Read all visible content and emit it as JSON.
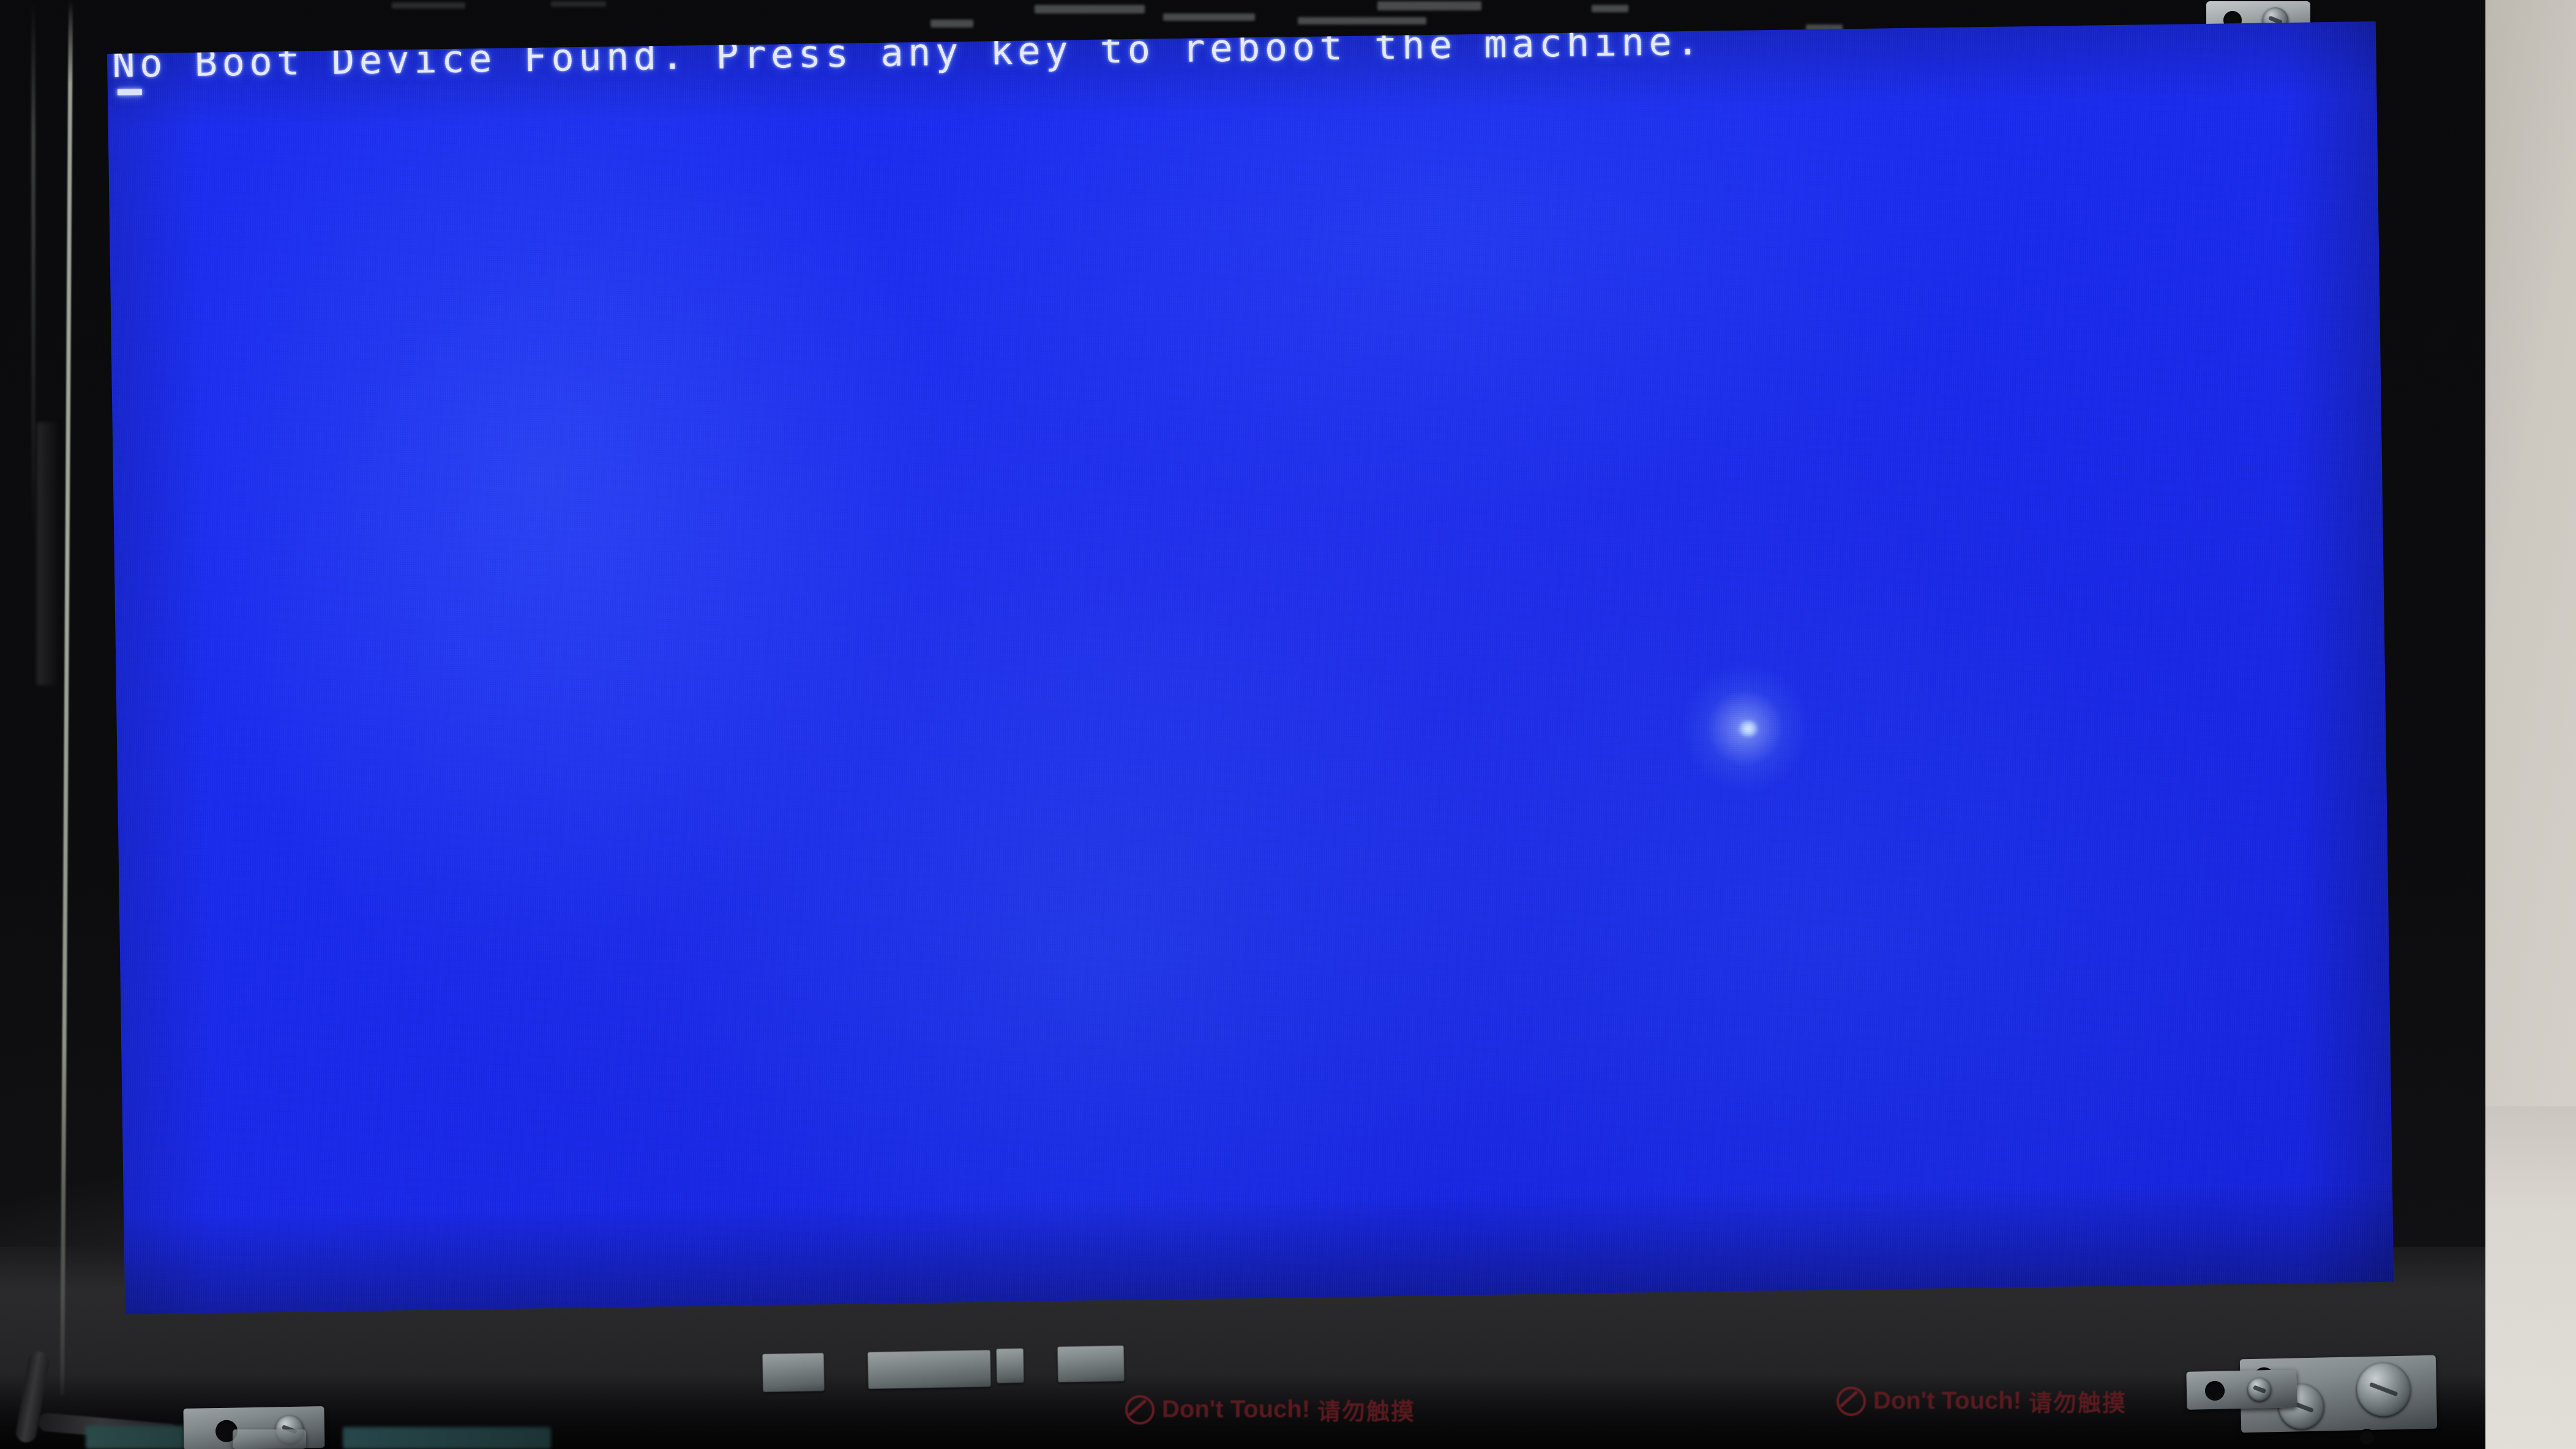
{
  "photo": {
    "subject": "disassembled-laptop-lcd-panel",
    "description": "Photograph of a partially disassembled laptop showing its LCD panel displaying a BIOS boot error on a blue background"
  },
  "screen": {
    "background_color": "#1A2BF0",
    "text_color": "#E8ECFF",
    "bios_message": "No Boot Device Found. Press any key to reboot the machine.",
    "cursor": "_",
    "cursor_name": "block-cursor"
  },
  "bezel": {
    "color": "#0B0B0D",
    "labels": [
      {
        "icon": "no-touch-icon",
        "english": "Don't Touch!",
        "chinese": "请勿触摸",
        "color": "#6B1C22"
      },
      {
        "icon": "no-touch-icon",
        "english": "Don't Touch!",
        "chinese": "请勿触摸",
        "color": "#6B1C22"
      }
    ]
  },
  "hardware": {
    "top_bracket": "metal-mounting-bracket",
    "hinge_brackets": [
      "left-hinge-bracket",
      "right-hinge-bracket"
    ],
    "screws": 3,
    "tape_strips": 4,
    "cable": "display-ribbon-cable"
  },
  "background": {
    "wall_color": "#D2CEC7"
  }
}
